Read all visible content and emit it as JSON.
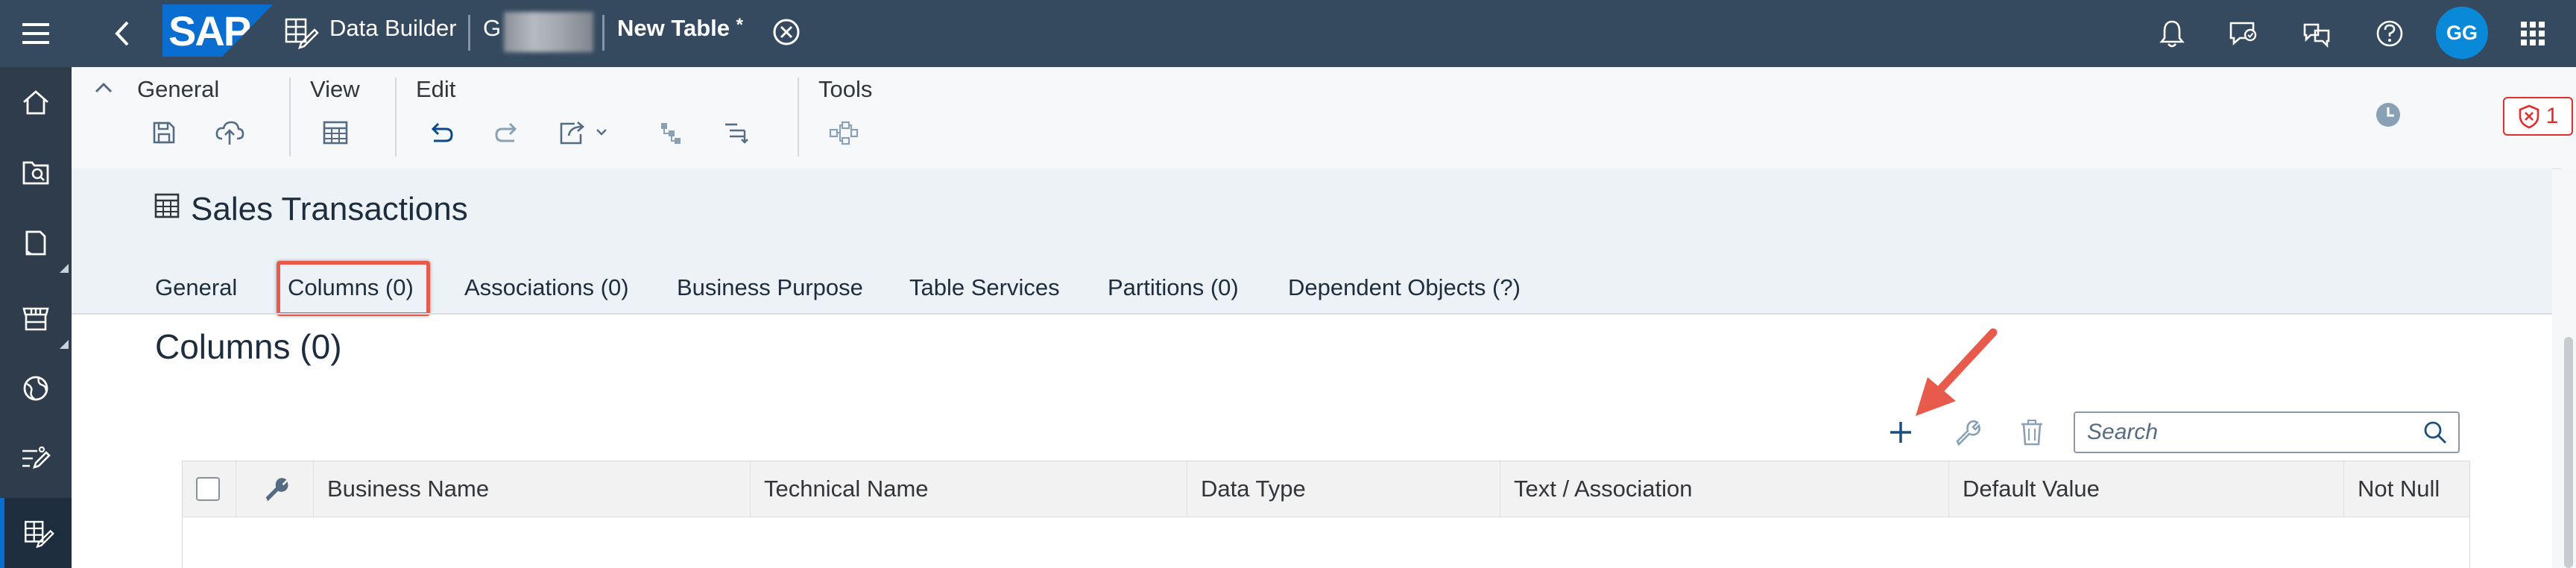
{
  "shell": {
    "app_title": "Data Builder",
    "space_name": "G",
    "document_title": "New Table",
    "document_title_suffix": "*",
    "avatar_initials": "GG",
    "logo_text": "SAP"
  },
  "toolbar": {
    "groups": {
      "general": "General",
      "view": "View",
      "edit": "Edit",
      "tools": "Tools"
    },
    "validation_count": "1"
  },
  "object": {
    "title": "Sales Transactions"
  },
  "tabs": [
    {
      "label": "General"
    },
    {
      "label": "Columns (0)",
      "active": true
    },
    {
      "label": "Associations (0)"
    },
    {
      "label": "Business Purpose"
    },
    {
      "label": "Table Services"
    },
    {
      "label": "Partitions (0)"
    },
    {
      "label": "Dependent Objects (?)"
    }
  ],
  "columns_section": {
    "title": "Columns (0)",
    "search_placeholder": "Search",
    "table_headers": [
      "Business Name",
      "Technical Name",
      "Data Type",
      "Text / Association",
      "Default Value",
      "Not Null"
    ],
    "rows": []
  },
  "colors": {
    "shell": "#354a5f",
    "sidenav": "#2f3c4b",
    "accent": "#0a6ed1",
    "highlight": "#e85a4b",
    "error": "#e22d2d"
  }
}
